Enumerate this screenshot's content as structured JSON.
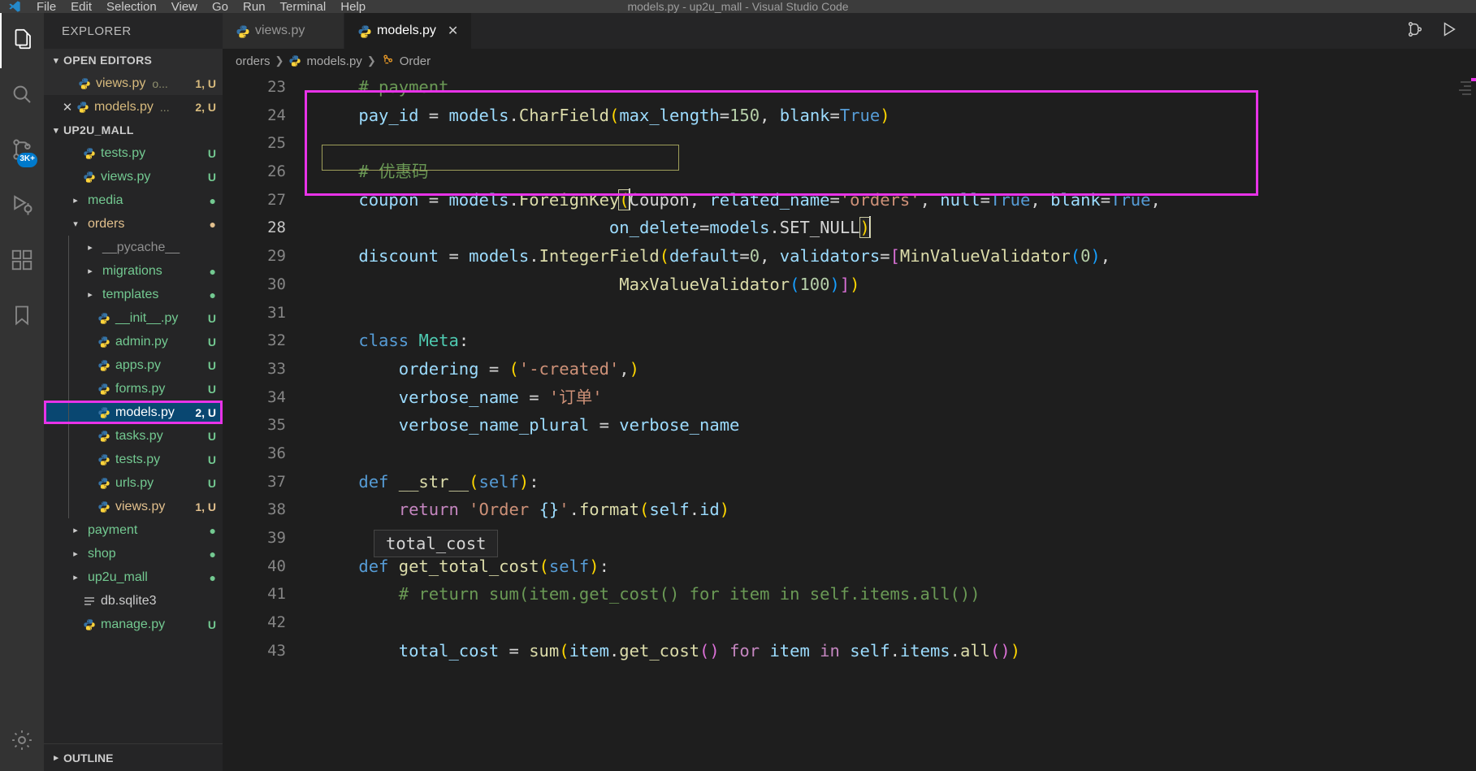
{
  "window": {
    "title": "models.py - up2u_mall - Visual Studio Code",
    "menu": [
      "File",
      "Edit",
      "Selection",
      "View",
      "Go",
      "Run",
      "Terminal",
      "Help"
    ]
  },
  "activitybar": {
    "items": [
      {
        "name": "explorer",
        "icon": "files-icon",
        "badge": ""
      },
      {
        "name": "search",
        "icon": "search-icon",
        "badge": ""
      },
      {
        "name": "source-control",
        "icon": "source-control-icon",
        "badge": "3K+"
      },
      {
        "name": "run-and-debug",
        "icon": "run-debug-icon",
        "badge": ""
      },
      {
        "name": "extensions",
        "icon": "extensions-icon",
        "badge": ""
      },
      {
        "name": "bookmarks",
        "icon": "bookmark-icon",
        "badge": ""
      }
    ],
    "bottom": {
      "name": "manage",
      "icon": "gear-icon"
    }
  },
  "sidebar": {
    "title": "EXPLORER",
    "open_editors": {
      "label": "OPEN EDITORS",
      "items": [
        {
          "name": "views.py",
          "icon": "python-icon",
          "path": "o...",
          "status": "1, U",
          "dirty": false,
          "color": "#d7ba7d"
        },
        {
          "name": "models.py",
          "icon": "python-icon",
          "path": "...",
          "status": "2, U",
          "dirty": false,
          "color": "#d7ba7d"
        }
      ]
    },
    "workspace": {
      "label": "UP2U_MALL",
      "items": [
        {
          "name": "tests.py",
          "type": "file",
          "icon": "python-icon",
          "indent": 1,
          "status": "U",
          "color": "#73c991"
        },
        {
          "name": "views.py",
          "type": "file",
          "icon": "python-icon",
          "indent": 1,
          "status": "U",
          "color": "#73c991"
        },
        {
          "name": "media",
          "type": "folder",
          "icon": "chevron-right-icon",
          "indent": 1,
          "status": "●",
          "color": "#73c991"
        },
        {
          "name": "orders",
          "type": "folder",
          "icon": "chevron-down-icon",
          "indent": 1,
          "status": "●",
          "color": "#e2c08d",
          "expanded": true
        },
        {
          "name": "__pycache__",
          "type": "folder",
          "icon": "chevron-right-icon",
          "indent": 2,
          "status": "",
          "color": "#8f8f8f"
        },
        {
          "name": "migrations",
          "type": "folder",
          "icon": "chevron-right-icon",
          "indent": 2,
          "status": "●",
          "color": "#73c991"
        },
        {
          "name": "templates",
          "type": "folder",
          "icon": "chevron-right-icon",
          "indent": 2,
          "status": "●",
          "color": "#73c991"
        },
        {
          "name": "__init__.py",
          "type": "file",
          "icon": "python-icon",
          "indent": 2,
          "status": "U",
          "color": "#73c991"
        },
        {
          "name": "admin.py",
          "type": "file",
          "icon": "python-icon",
          "indent": 2,
          "status": "U",
          "color": "#73c991"
        },
        {
          "name": "apps.py",
          "type": "file",
          "icon": "python-icon",
          "indent": 2,
          "status": "U",
          "color": "#73c991"
        },
        {
          "name": "forms.py",
          "type": "file",
          "icon": "python-icon",
          "indent": 2,
          "status": "U",
          "color": "#73c991"
        },
        {
          "name": "models.py",
          "type": "file",
          "icon": "python-icon",
          "indent": 2,
          "status": "2, U",
          "color": "#ffffff",
          "selected": true,
          "highlighted": true
        },
        {
          "name": "tasks.py",
          "type": "file",
          "icon": "python-icon",
          "indent": 2,
          "status": "U",
          "color": "#73c991"
        },
        {
          "name": "tests.py",
          "type": "file",
          "icon": "python-icon",
          "indent": 2,
          "status": "U",
          "color": "#73c991"
        },
        {
          "name": "urls.py",
          "type": "file",
          "icon": "python-icon",
          "indent": 2,
          "status": "U",
          "color": "#73c991"
        },
        {
          "name": "views.py",
          "type": "file",
          "icon": "python-icon",
          "indent": 2,
          "status": "1, U",
          "color": "#e2c08d"
        },
        {
          "name": "payment",
          "type": "folder",
          "icon": "chevron-right-icon",
          "indent": 1,
          "status": "●",
          "color": "#73c991"
        },
        {
          "name": "shop",
          "type": "folder",
          "icon": "chevron-right-icon",
          "indent": 1,
          "status": "●",
          "color": "#73c991"
        },
        {
          "name": "up2u_mall",
          "type": "folder",
          "icon": "chevron-right-icon",
          "indent": 1,
          "status": "●",
          "color": "#73c991"
        },
        {
          "name": "db.sqlite3",
          "type": "file",
          "icon": "database-icon",
          "indent": 1,
          "status": "",
          "color": "#cccccc"
        },
        {
          "name": "manage.py",
          "type": "file",
          "icon": "python-icon",
          "indent": 1,
          "status": "U",
          "color": "#73c991"
        }
      ]
    },
    "outline_label": "OUTLINE"
  },
  "editor": {
    "tabs": [
      {
        "label": "views.py",
        "icon": "python-icon",
        "active": false,
        "closable": false
      },
      {
        "label": "models.py",
        "icon": "python-icon",
        "active": true,
        "closable": true
      }
    ],
    "tab_actions": [
      {
        "name": "split-editor-icon",
        "label": "⎇"
      },
      {
        "name": "run-python-file-icon",
        "label": "▷"
      }
    ],
    "breadcrumbs": [
      {
        "label": "orders",
        "icon": ""
      },
      {
        "label": "models.py",
        "icon": "python-icon"
      },
      {
        "label": "Order",
        "icon": "class-icon"
      }
    ],
    "suggest_widget": {
      "text": "total_cost"
    },
    "first_line_number": 23,
    "lines": [
      {
        "n": 23,
        "tokens": [
          {
            "t": "    ",
            "c": "pln"
          },
          {
            "t": "# payment",
            "c": "com"
          }
        ]
      },
      {
        "n": 24,
        "tokens": [
          {
            "t": "    ",
            "c": "pln"
          },
          {
            "t": "pay_id",
            "c": "var"
          },
          {
            "t": " = ",
            "c": "pln"
          },
          {
            "t": "models",
            "c": "var"
          },
          {
            "t": ".",
            "c": "pln"
          },
          {
            "t": "CharField",
            "c": "fn"
          },
          {
            "t": "(",
            "c": "par-y"
          },
          {
            "t": "max_length",
            "c": "var"
          },
          {
            "t": "=",
            "c": "pln"
          },
          {
            "t": "150",
            "c": "num"
          },
          {
            "t": ", ",
            "c": "pln"
          },
          {
            "t": "blank",
            "c": "var"
          },
          {
            "t": "=",
            "c": "pln"
          },
          {
            "t": "True",
            "c": "kw"
          },
          {
            "t": ")",
            "c": "par-y"
          }
        ]
      },
      {
        "n": 25,
        "tokens": []
      },
      {
        "n": 26,
        "tokens": [
          {
            "t": "    ",
            "c": "pln"
          },
          {
            "t": "# 优惠码",
            "c": "com"
          }
        ]
      },
      {
        "n": 27,
        "tokens": [
          {
            "t": "    ",
            "c": "pln"
          },
          {
            "t": "coupon",
            "c": "var"
          },
          {
            "t": " = ",
            "c": "pln"
          },
          {
            "t": "models",
            "c": "var"
          },
          {
            "t": ".",
            "c": "pln"
          },
          {
            "t": "ForeignKey",
            "c": "fn"
          },
          {
            "t": "(",
            "c": "par-y"
          },
          {
            "t": "Coupon",
            "c": "pln"
          },
          {
            "t": ", ",
            "c": "pln"
          },
          {
            "t": "related_name",
            "c": "var"
          },
          {
            "t": "=",
            "c": "pln"
          },
          {
            "t": "'orders'",
            "c": "str"
          },
          {
            "t": ", ",
            "c": "pln"
          },
          {
            "t": "null",
            "c": "var"
          },
          {
            "t": "=",
            "c": "pln"
          },
          {
            "t": "True",
            "c": "kw"
          },
          {
            "t": ", ",
            "c": "pln"
          },
          {
            "t": "blank",
            "c": "var"
          },
          {
            "t": "=",
            "c": "pln"
          },
          {
            "t": "True",
            "c": "kw"
          },
          {
            "t": ",",
            "c": "pln"
          }
        ]
      },
      {
        "n": 28,
        "tokens": [
          {
            "t": "                             ",
            "c": "pln"
          },
          {
            "t": "on_delete",
            "c": "var"
          },
          {
            "t": "=",
            "c": "pln"
          },
          {
            "t": "models",
            "c": "var"
          },
          {
            "t": ".",
            "c": "pln"
          },
          {
            "t": "SET_NULL",
            "c": "pln"
          },
          {
            "t": ")",
            "c": "par-y"
          }
        ]
      },
      {
        "n": 29,
        "tokens": [
          {
            "t": "    ",
            "c": "pln"
          },
          {
            "t": "discount",
            "c": "var"
          },
          {
            "t": " = ",
            "c": "pln"
          },
          {
            "t": "models",
            "c": "var"
          },
          {
            "t": ".",
            "c": "pln"
          },
          {
            "t": "IntegerField",
            "c": "fn"
          },
          {
            "t": "(",
            "c": "par-y"
          },
          {
            "t": "default",
            "c": "var"
          },
          {
            "t": "=",
            "c": "pln"
          },
          {
            "t": "0",
            "c": "num"
          },
          {
            "t": ", ",
            "c": "pln"
          },
          {
            "t": "validators",
            "c": "var"
          },
          {
            "t": "=",
            "c": "pln"
          },
          {
            "t": "[",
            "c": "par-p"
          },
          {
            "t": "MinValueValidator",
            "c": "fn"
          },
          {
            "t": "(",
            "c": "par-b"
          },
          {
            "t": "0",
            "c": "num"
          },
          {
            "t": ")",
            "c": "par-b"
          },
          {
            "t": ",",
            "c": "pln"
          }
        ]
      },
      {
        "n": 30,
        "tokens": [
          {
            "t": "                              ",
            "c": "pln"
          },
          {
            "t": "MaxValueValidator",
            "c": "fn"
          },
          {
            "t": "(",
            "c": "par-b"
          },
          {
            "t": "100",
            "c": "num"
          },
          {
            "t": ")",
            "c": "par-b"
          },
          {
            "t": "]",
            "c": "par-p"
          },
          {
            "t": ")",
            "c": "par-y"
          }
        ]
      },
      {
        "n": 31,
        "tokens": []
      },
      {
        "n": 32,
        "tokens": [
          {
            "t": "    ",
            "c": "pln"
          },
          {
            "t": "class",
            "c": "kw"
          },
          {
            "t": " ",
            "c": "pln"
          },
          {
            "t": "Meta",
            "c": "cls"
          },
          {
            "t": ":",
            "c": "pln"
          }
        ]
      },
      {
        "n": 33,
        "tokens": [
          {
            "t": "        ",
            "c": "pln"
          },
          {
            "t": "ordering",
            "c": "var"
          },
          {
            "t": " = ",
            "c": "pln"
          },
          {
            "t": "(",
            "c": "par-y"
          },
          {
            "t": "'-created'",
            "c": "str"
          },
          {
            "t": ",",
            "c": "pln"
          },
          {
            "t": ")",
            "c": "par-y"
          }
        ]
      },
      {
        "n": 34,
        "tokens": [
          {
            "t": "        ",
            "c": "pln"
          },
          {
            "t": "verbose_name",
            "c": "var"
          },
          {
            "t": " = ",
            "c": "pln"
          },
          {
            "t": "'订单'",
            "c": "str"
          }
        ]
      },
      {
        "n": 35,
        "tokens": [
          {
            "t": "        ",
            "c": "pln"
          },
          {
            "t": "verbose_name_plural",
            "c": "var"
          },
          {
            "t": " = ",
            "c": "pln"
          },
          {
            "t": "verbose_name",
            "c": "var"
          }
        ]
      },
      {
        "n": 36,
        "tokens": []
      },
      {
        "n": 37,
        "tokens": [
          {
            "t": "    ",
            "c": "pln"
          },
          {
            "t": "def",
            "c": "kw"
          },
          {
            "t": " ",
            "c": "pln"
          },
          {
            "t": "__str__",
            "c": "fn"
          },
          {
            "t": "(",
            "c": "par-y"
          },
          {
            "t": "self",
            "c": "kw"
          },
          {
            "t": ")",
            "c": "par-y"
          },
          {
            "t": ":",
            "c": "pln"
          }
        ]
      },
      {
        "n": 38,
        "tokens": [
          {
            "t": "        ",
            "c": "pln"
          },
          {
            "t": "return",
            "c": "ctl"
          },
          {
            "t": " ",
            "c": "pln"
          },
          {
            "t": "'Order ",
            "c": "str"
          },
          {
            "t": "{}",
            "c": "var"
          },
          {
            "t": "'",
            "c": "str"
          },
          {
            "t": ".",
            "c": "pln"
          },
          {
            "t": "format",
            "c": "fn"
          },
          {
            "t": "(",
            "c": "par-y"
          },
          {
            "t": "self",
            "c": "self"
          },
          {
            "t": ".",
            "c": "pln"
          },
          {
            "t": "id",
            "c": "var"
          },
          {
            "t": ")",
            "c": "par-y"
          }
        ]
      },
      {
        "n": 39,
        "tokens": []
      },
      {
        "n": 40,
        "tokens": [
          {
            "t": "    ",
            "c": "pln"
          },
          {
            "t": "def",
            "c": "kw"
          },
          {
            "t": " ",
            "c": "pln"
          },
          {
            "t": "get_total_cost",
            "c": "fn"
          },
          {
            "t": "(",
            "c": "par-y"
          },
          {
            "t": "self",
            "c": "kw"
          },
          {
            "t": ")",
            "c": "par-y"
          },
          {
            "t": ":",
            "c": "pln"
          }
        ]
      },
      {
        "n": 41,
        "tokens": [
          {
            "t": "        ",
            "c": "pln"
          },
          {
            "t": "# return sum(item.get_cost() for item in self.items.all())",
            "c": "com"
          }
        ]
      },
      {
        "n": 42,
        "tokens": []
      },
      {
        "n": 43,
        "tokens": [
          {
            "t": "        ",
            "c": "pln"
          },
          {
            "t": "total_cost",
            "c": "var"
          },
          {
            "t": " = ",
            "c": "pln"
          },
          {
            "t": "sum",
            "c": "fn"
          },
          {
            "t": "(",
            "c": "par-y"
          },
          {
            "t": "item",
            "c": "var"
          },
          {
            "t": ".",
            "c": "pln"
          },
          {
            "t": "get_cost",
            "c": "fn"
          },
          {
            "t": "(",
            "c": "par-p"
          },
          {
            "t": ")",
            "c": "par-p"
          },
          {
            "t": " ",
            "c": "pln"
          },
          {
            "t": "for",
            "c": "ctl"
          },
          {
            "t": " ",
            "c": "pln"
          },
          {
            "t": "item",
            "c": "var"
          },
          {
            "t": " ",
            "c": "pln"
          },
          {
            "t": "in",
            "c": "ctl"
          },
          {
            "t": " ",
            "c": "pln"
          },
          {
            "t": "self",
            "c": "self"
          },
          {
            "t": ".",
            "c": "pln"
          },
          {
            "t": "items",
            "c": "var"
          },
          {
            "t": ".",
            "c": "pln"
          },
          {
            "t": "all",
            "c": "fn"
          },
          {
            "t": "(",
            "c": "par-p"
          },
          {
            "t": ")",
            "c": "par-p"
          },
          {
            "t": ")",
            "c": "par-y"
          }
        ]
      }
    ]
  },
  "colors": {
    "annotation": "#e833e8",
    "selection": "#094771",
    "accent": "#007acc",
    "editor_bg": "#1e1e1e",
    "sidebar_bg": "#252526",
    "activitybar_bg": "#333333"
  }
}
